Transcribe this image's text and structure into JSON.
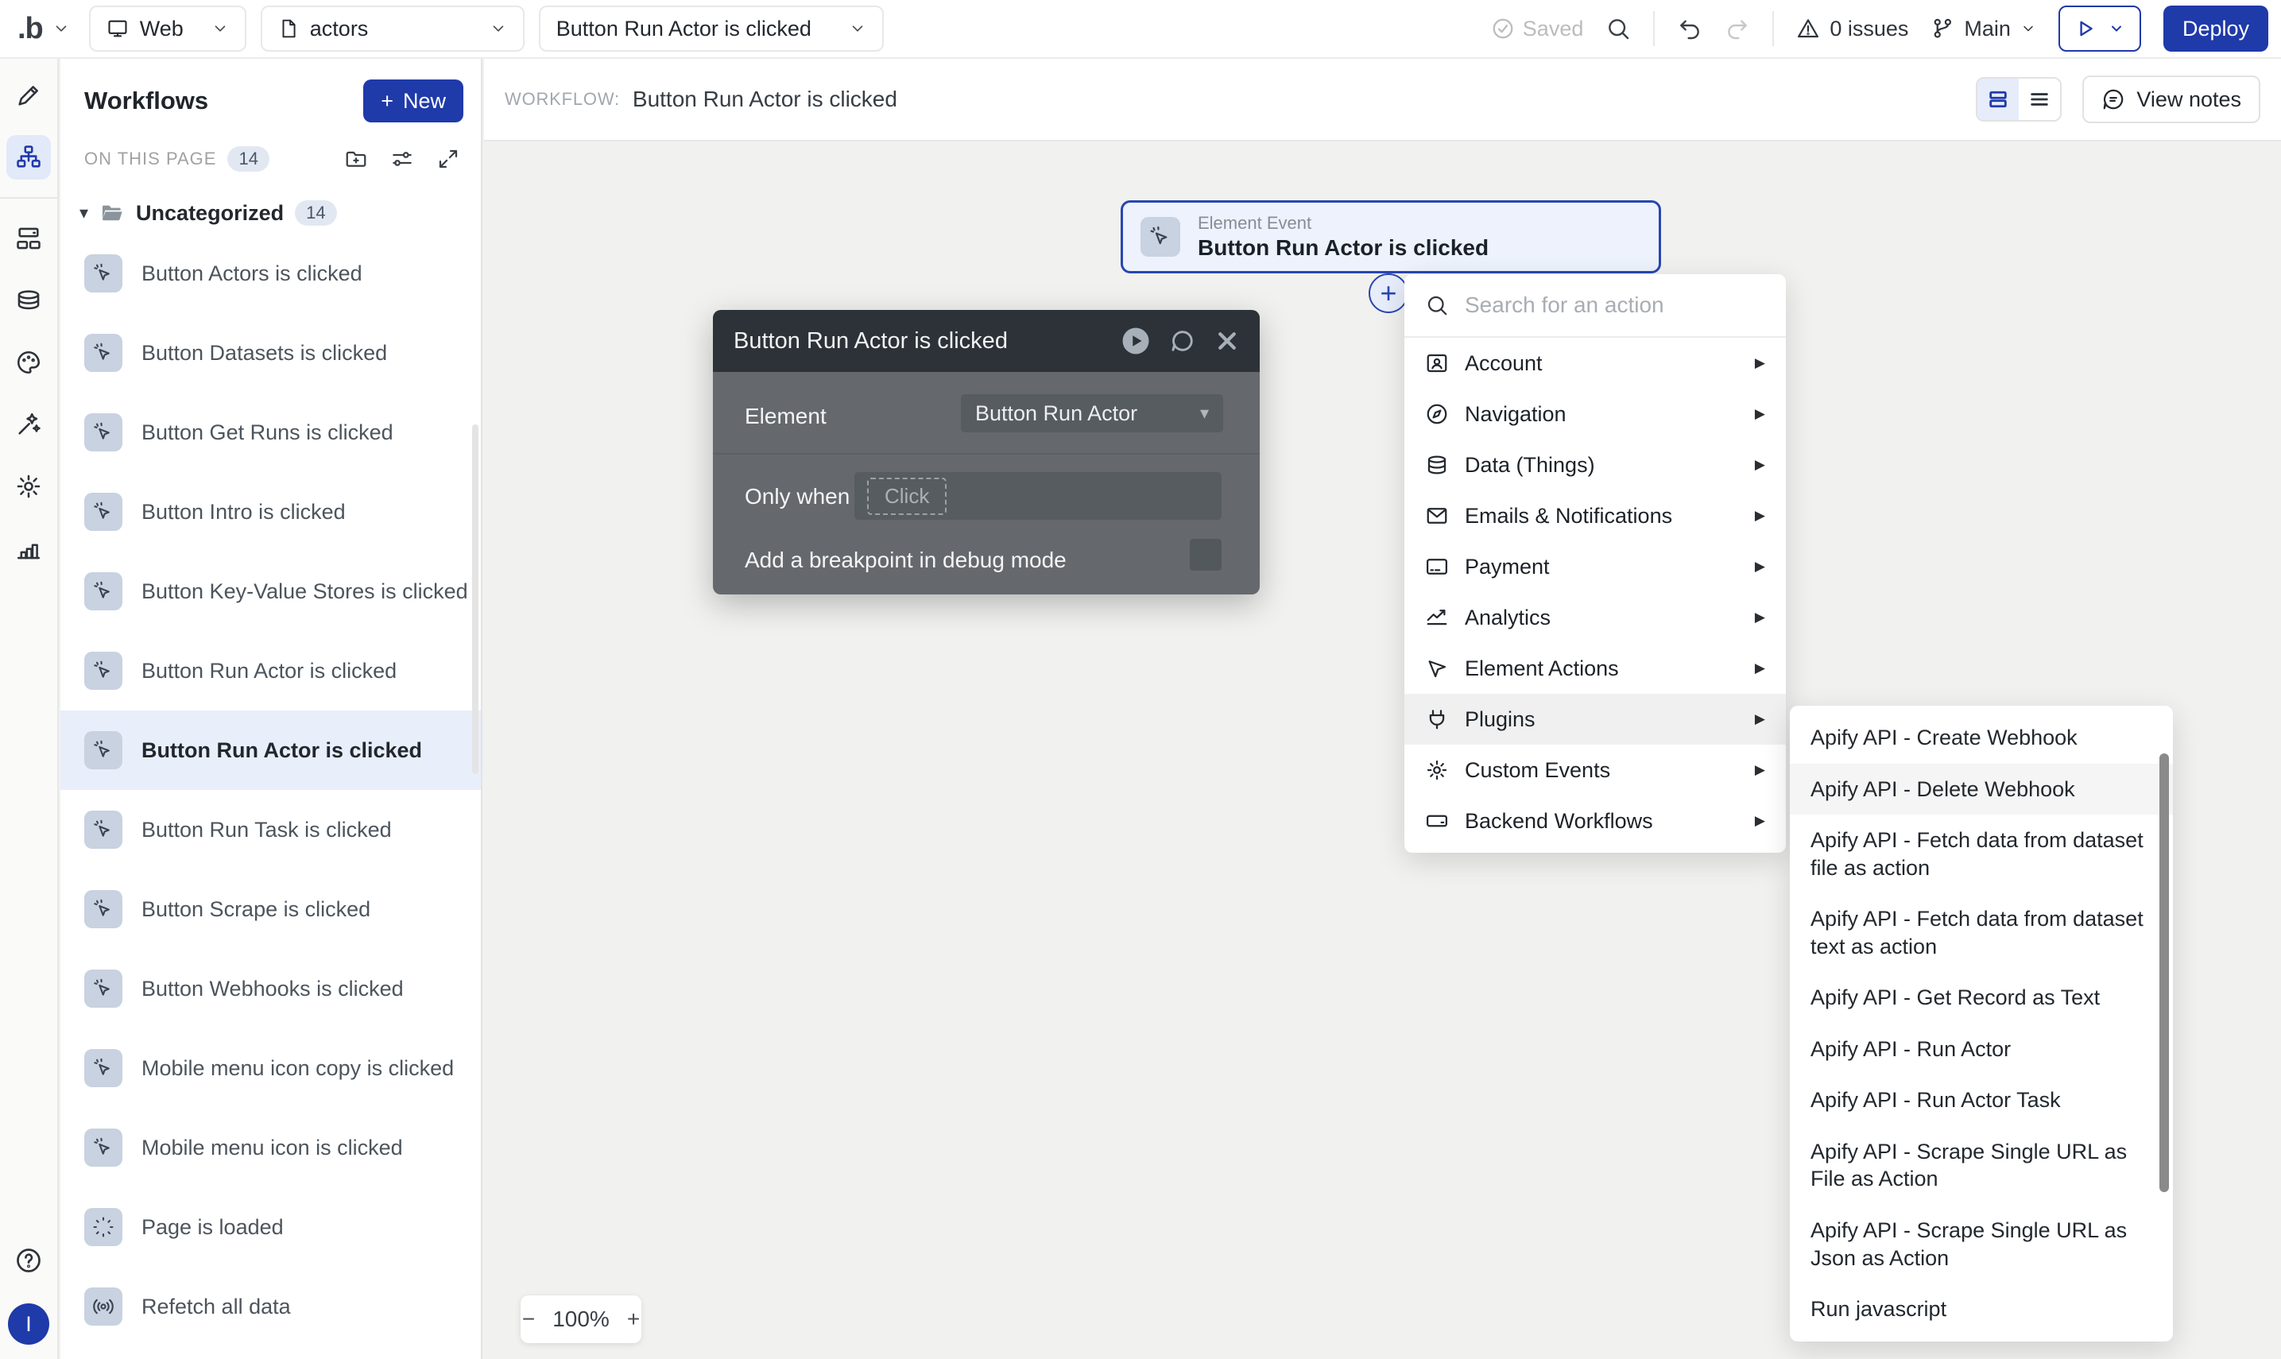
{
  "topbar": {
    "logo": ".b",
    "platform_select": "Web",
    "page_select": "actors",
    "workflow_select": "Button Run Actor is clicked",
    "saved_label": "Saved",
    "issues_label": "0 issues",
    "branch_label": "Main",
    "deploy_label": "Deploy"
  },
  "icons": {
    "chevron_down": "⌄",
    "select_chevron": "▾",
    "folder_caret": "▾",
    "submenu_arrow": "▶",
    "plus": "+",
    "minus": "−"
  },
  "colors": {
    "accent_blue": "#1f3aa9",
    "node_border_blue": "#2946b1",
    "dialog_header": "#2c3238",
    "dialog_body": "#65696e",
    "canvas_bg": "#f1f1ef",
    "selected_row_bg": "#e9eefb",
    "chip_bg": "#c8d2e0"
  },
  "workflows_panel": {
    "title": "Workflows",
    "new_label": "New",
    "on_this_page": "ON THIS PAGE",
    "on_this_page_count": "14",
    "folder": {
      "name": "Uncategorized",
      "count": "14"
    },
    "items": [
      {
        "label": "Button Actors is clicked"
      },
      {
        "label": "Button Datasets is clicked"
      },
      {
        "label": "Button Get Runs is clicked"
      },
      {
        "label": "Button Intro is clicked"
      },
      {
        "label": "Button Key-Value Stores is clicked"
      },
      {
        "label": "Button Run Actor is clicked"
      },
      {
        "label": "Button Run Actor is clicked"
      },
      {
        "label": "Button Run Task is clicked"
      },
      {
        "label": "Button Scrape is clicked"
      },
      {
        "label": "Button Webhooks is clicked"
      },
      {
        "label": "Mobile menu icon copy is clicked"
      },
      {
        "label": "Mobile menu icon is clicked"
      },
      {
        "label": "Page is loaded"
      },
      {
        "label": "Refetch all data"
      }
    ]
  },
  "canvas_header": {
    "workflow_label": "WORKFLOW:",
    "workflow_title": "Button Run Actor is clicked",
    "view_notes_label": "View notes"
  },
  "node": {
    "type_label": "Element Event",
    "title": "Button Run Actor is clicked"
  },
  "dialog": {
    "title": "Button Run Actor is clicked",
    "element_label": "Element",
    "element_value": "Button Run Actor",
    "only_when_label": "Only when",
    "only_when_placeholder": "Click",
    "breakpoint_label": "Add a breakpoint in debug mode"
  },
  "action_menu": {
    "search_placeholder": "Search for an action",
    "items": [
      {
        "label": "Account"
      },
      {
        "label": "Navigation"
      },
      {
        "label": "Data (Things)"
      },
      {
        "label": "Emails & Notifications"
      },
      {
        "label": "Payment"
      },
      {
        "label": "Analytics"
      },
      {
        "label": "Element Actions"
      },
      {
        "label": "Plugins"
      },
      {
        "label": "Custom Events"
      },
      {
        "label": "Backend Workflows"
      }
    ]
  },
  "plugins_submenu": {
    "items": [
      {
        "label": "Apify API - Create Webhook"
      },
      {
        "label": "Apify API - Delete Webhook"
      },
      {
        "label": "Apify API - Fetch data from dataset file as action"
      },
      {
        "label": "Apify API - Fetch data from dataset text as action"
      },
      {
        "label": "Apify API - Get Record as Text"
      },
      {
        "label": "Apify API - Run Actor"
      },
      {
        "label": "Apify API - Run Actor Task"
      },
      {
        "label": "Apify API - Scrape Single URL as File as Action"
      },
      {
        "label": "Apify API - Scrape Single URL as Json as Action"
      },
      {
        "label": "Run javascript"
      }
    ]
  },
  "zoom_control": {
    "level": "100%"
  },
  "avatar_initial": "I"
}
